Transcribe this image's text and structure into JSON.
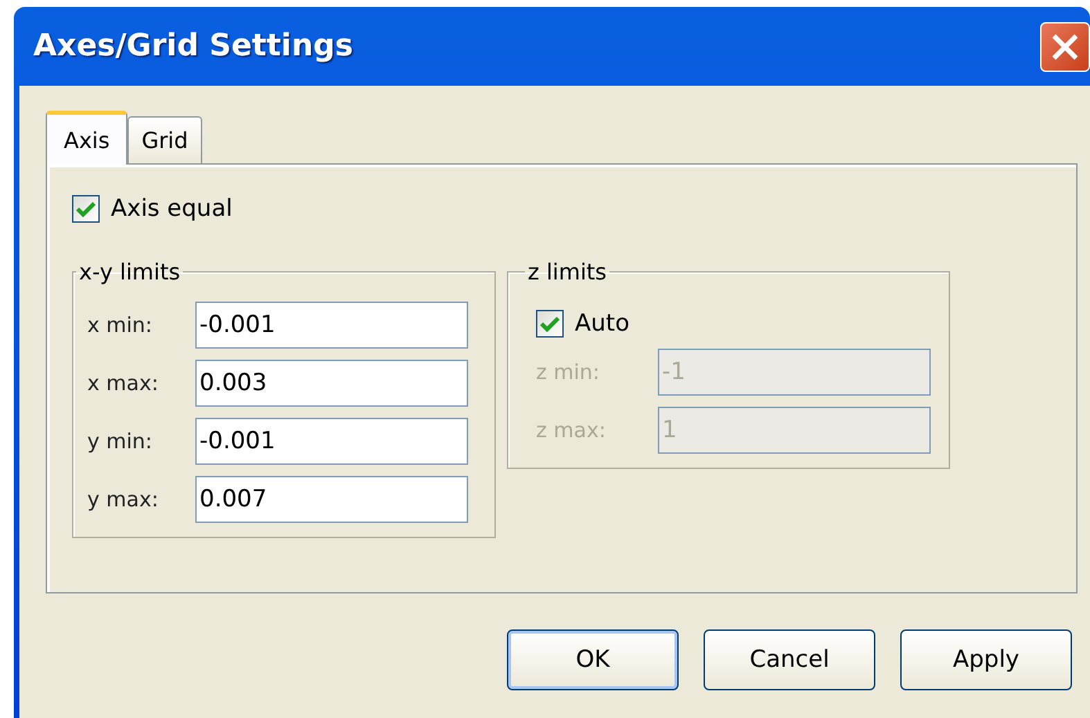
{
  "window": {
    "title": "Axes/Grid Settings"
  },
  "tabs": [
    {
      "label": "Axis",
      "selected": true
    },
    {
      "label": "Grid",
      "selected": false
    }
  ],
  "axis_equal": {
    "label": "Axis equal",
    "checked": true
  },
  "xy_limits": {
    "title": "x-y limits",
    "fields": [
      {
        "label": "x min:",
        "value": "-0.001",
        "disabled": false
      },
      {
        "label": "x max:",
        "value": "0.003",
        "disabled": false
      },
      {
        "label": "y min:",
        "value": "-0.001",
        "disabled": false
      },
      {
        "label": "y max:",
        "value": "0.007",
        "disabled": false
      }
    ]
  },
  "z_limits": {
    "title": "z limits",
    "auto": {
      "label": "Auto",
      "checked": true
    },
    "fields": [
      {
        "label": "z min:",
        "value": "-1",
        "disabled": true
      },
      {
        "label": "z max:",
        "value": "1",
        "disabled": true
      }
    ]
  },
  "buttons": [
    {
      "label": "OK",
      "default": true
    },
    {
      "label": "Cancel",
      "default": false
    },
    {
      "label": "Apply",
      "default": false
    }
  ]
}
